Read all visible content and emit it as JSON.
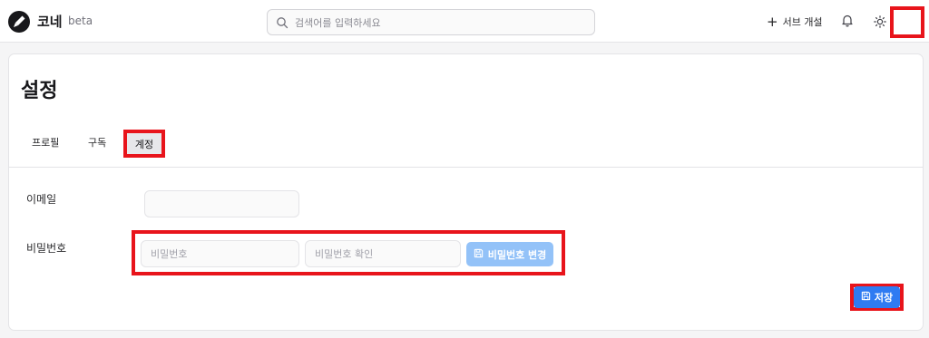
{
  "header": {
    "brand": "코네",
    "badge": "beta",
    "search_placeholder": "검색어를 입력하세요",
    "create_label": "서브 개설"
  },
  "page": {
    "title": "설정",
    "tabs": [
      {
        "label": "프로필"
      },
      {
        "label": "구독"
      },
      {
        "label": "계정",
        "active": true
      }
    ]
  },
  "form": {
    "email_label": "이메일",
    "email_value": "",
    "password_label": "비밀번호",
    "password_placeholder": "비밀번호",
    "password_confirm_placeholder": "비밀번호 확인",
    "change_password_label": "비밀번호 변경",
    "save_label": "저장"
  },
  "colors": {
    "accent": "#2f7bf2",
    "accent_disabled": "#93c2f8",
    "highlight": "#e8141b"
  },
  "icons": [
    "logo-icon",
    "search-icon",
    "plus-icon",
    "bell-icon",
    "sun-icon",
    "save-icon"
  ]
}
